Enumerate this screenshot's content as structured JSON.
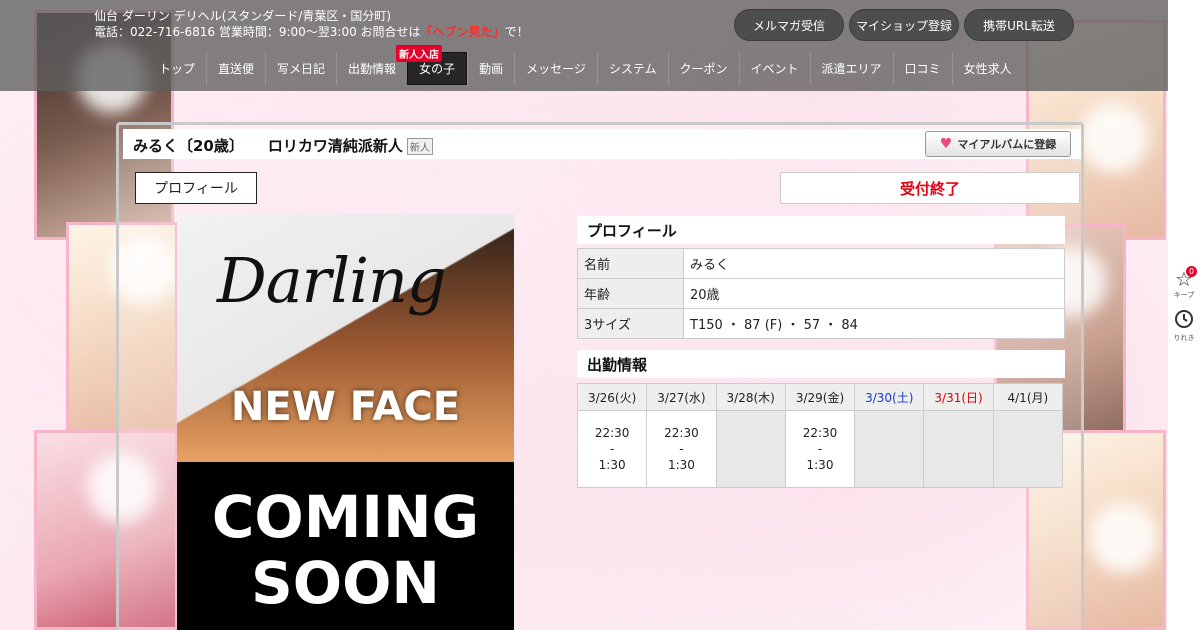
{
  "shop": {
    "line1": "仙台 ダーリン デリヘル(スタンダード/青葉区・国分町)",
    "line2_prefix": "電話：022-716-6816 営業時間：9:00～翌3:00 お問合せは",
    "line2_highlight": "「ヘブン見た」",
    "line2_suffix": "で！"
  },
  "header_buttons": [
    "メルマガ受信",
    "マイショップ登録",
    "携帯URL転送"
  ],
  "nav": {
    "items": [
      "トップ",
      "直送便",
      "写メ日記",
      "出勤情報",
      "女の子",
      "動画",
      "メッセージ",
      "システム",
      "クーポン",
      "イベント",
      "派遣エリア",
      "口コミ",
      "女性求人"
    ],
    "active_index": 4,
    "badge": "新人入店"
  },
  "girl": {
    "name_age": "みるく〔20歳〕",
    "catchphrase": "ロリカワ清純派新人",
    "tag": "新人",
    "album_button": "マイアルバムに登録",
    "profile_tab": "プロフィール",
    "status": "受付終了"
  },
  "photo": {
    "logo": "Darling",
    "line1": "NEW FACE",
    "line2": "COMING",
    "line3": "SOON"
  },
  "profile": {
    "title": "プロフィール",
    "rows": [
      {
        "label": "名前",
        "value": "みるく"
      },
      {
        "label": "年齢",
        "value": "20歳"
      },
      {
        "label": "3サイズ",
        "value": "T150 ・ 87 (F) ・ 57 ・ 84"
      }
    ]
  },
  "schedule": {
    "title": "出勤情報",
    "days": [
      {
        "date": "3/26(火)",
        "type": "weekday",
        "start": "22:30",
        "sep": "-",
        "end": "1:30"
      },
      {
        "date": "3/27(水)",
        "type": "weekday",
        "start": "22:30",
        "sep": "-",
        "end": "1:30"
      },
      {
        "date": "3/28(木)",
        "type": "weekday",
        "start": "",
        "sep": "",
        "end": ""
      },
      {
        "date": "3/29(金)",
        "type": "weekday",
        "start": "22:30",
        "sep": "-",
        "end": "1:30"
      },
      {
        "date": "3/30(土)",
        "type": "saturday",
        "start": "",
        "sep": "",
        "end": ""
      },
      {
        "date": "3/31(日)",
        "type": "sunday",
        "start": "",
        "sep": "",
        "end": ""
      },
      {
        "date": "4/1(月)",
        "type": "weekday",
        "start": "",
        "sep": "",
        "end": ""
      }
    ]
  },
  "sidetools": {
    "keep_label": "キープ",
    "keep_count": "0",
    "history_label": "りれき"
  },
  "colors": {
    "header_bg": "#5f5f5f",
    "accent_red": "#e60012",
    "saturday_blue": "#1a3cc8",
    "sunday_red": "#dd0000"
  }
}
